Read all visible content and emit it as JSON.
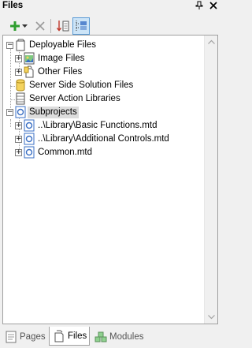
{
  "panel": {
    "title": "Files",
    "pin_glyph": "▼ ",
    "close_glyph": "✕"
  },
  "toolbar": {
    "add_glyph": "+",
    "dropdown_glyph": "▾",
    "delete_glyph": "✕"
  },
  "tree": {
    "deployable_files": "Deployable Files",
    "image_files": "Image Files",
    "other_files": "Other Files",
    "server_side_solution_files": "Server Side Solution Files",
    "server_action_libraries": "Server Action Libraries",
    "subprojects": "Subprojects",
    "sub1": "..\\Library\\Basic Functions.mtd",
    "sub2": "..\\Library\\Additional Controls.mtd",
    "sub3": "Common.mtd",
    "expander_collapsed": "+",
    "expander_expanded": "−"
  },
  "tabs": {
    "pages": "Pages",
    "files": "Files",
    "modules": "Modules"
  },
  "colors": {
    "add_green": "#2e9e2e",
    "selection": "#dcdcdc",
    "folder_yellow": "#f4d35e",
    "doc_blue": "#3a6fc4"
  }
}
